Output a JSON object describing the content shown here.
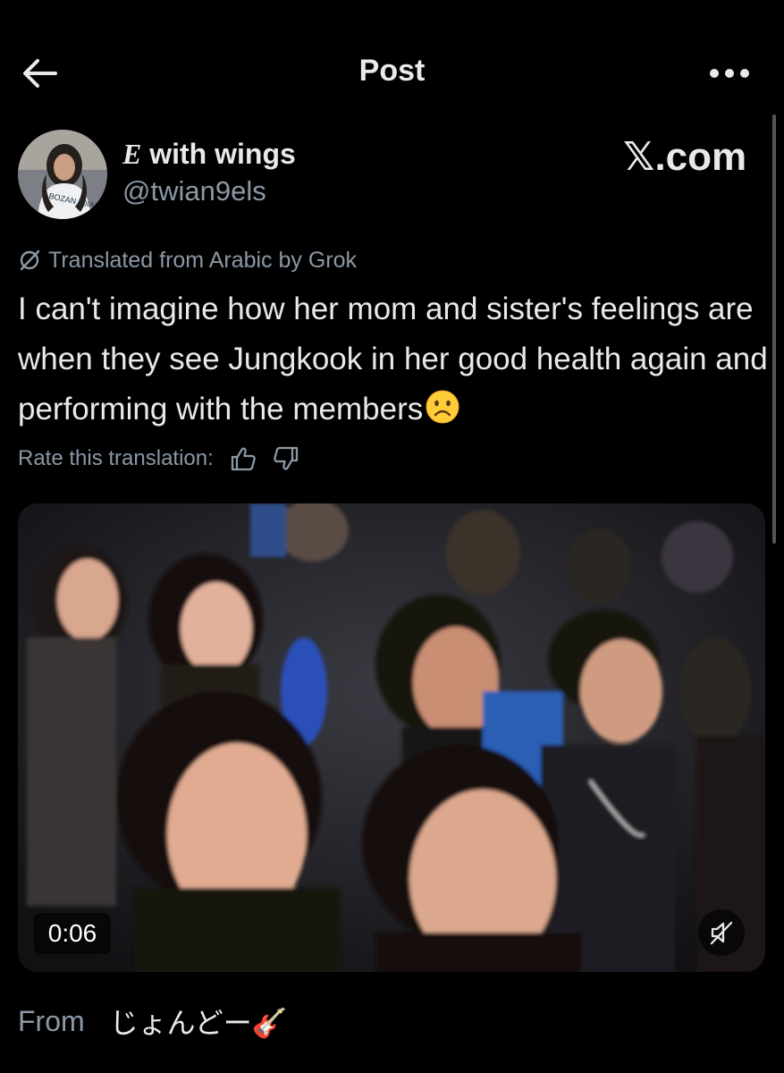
{
  "header": {
    "title": "Post",
    "back_icon": "arrow-left-icon",
    "more_icon": "more-horizontal-icon"
  },
  "author": {
    "name_initial": "E",
    "name_rest": " with wings",
    "handle": "@twian9els",
    "avatar_shirt_text": "BOZAN 70IAI"
  },
  "brand": {
    "text": "𝕏.com"
  },
  "translation": {
    "note": "Translated from Arabic by Grok",
    "rate_label": "Rate this translation:",
    "icons": [
      "grok-slash-icon",
      "thumbs-up-icon",
      "thumbs-down-icon"
    ]
  },
  "post": {
    "text": "I can't imagine how her mom and sister's feelings are when they see Jungkook in her good health again and performing with the members",
    "emoji": "frowning-face-emoji"
  },
  "media": {
    "type": "video",
    "time": "0:06",
    "mute_icon": "speaker-muted-icon",
    "description": ""
  },
  "footer": {
    "from_label": "From",
    "source_name": "じょんどー🎸"
  },
  "colors": {
    "background": "#000000",
    "text": "#e7e9ea",
    "secondary": "#8b98a5"
  }
}
